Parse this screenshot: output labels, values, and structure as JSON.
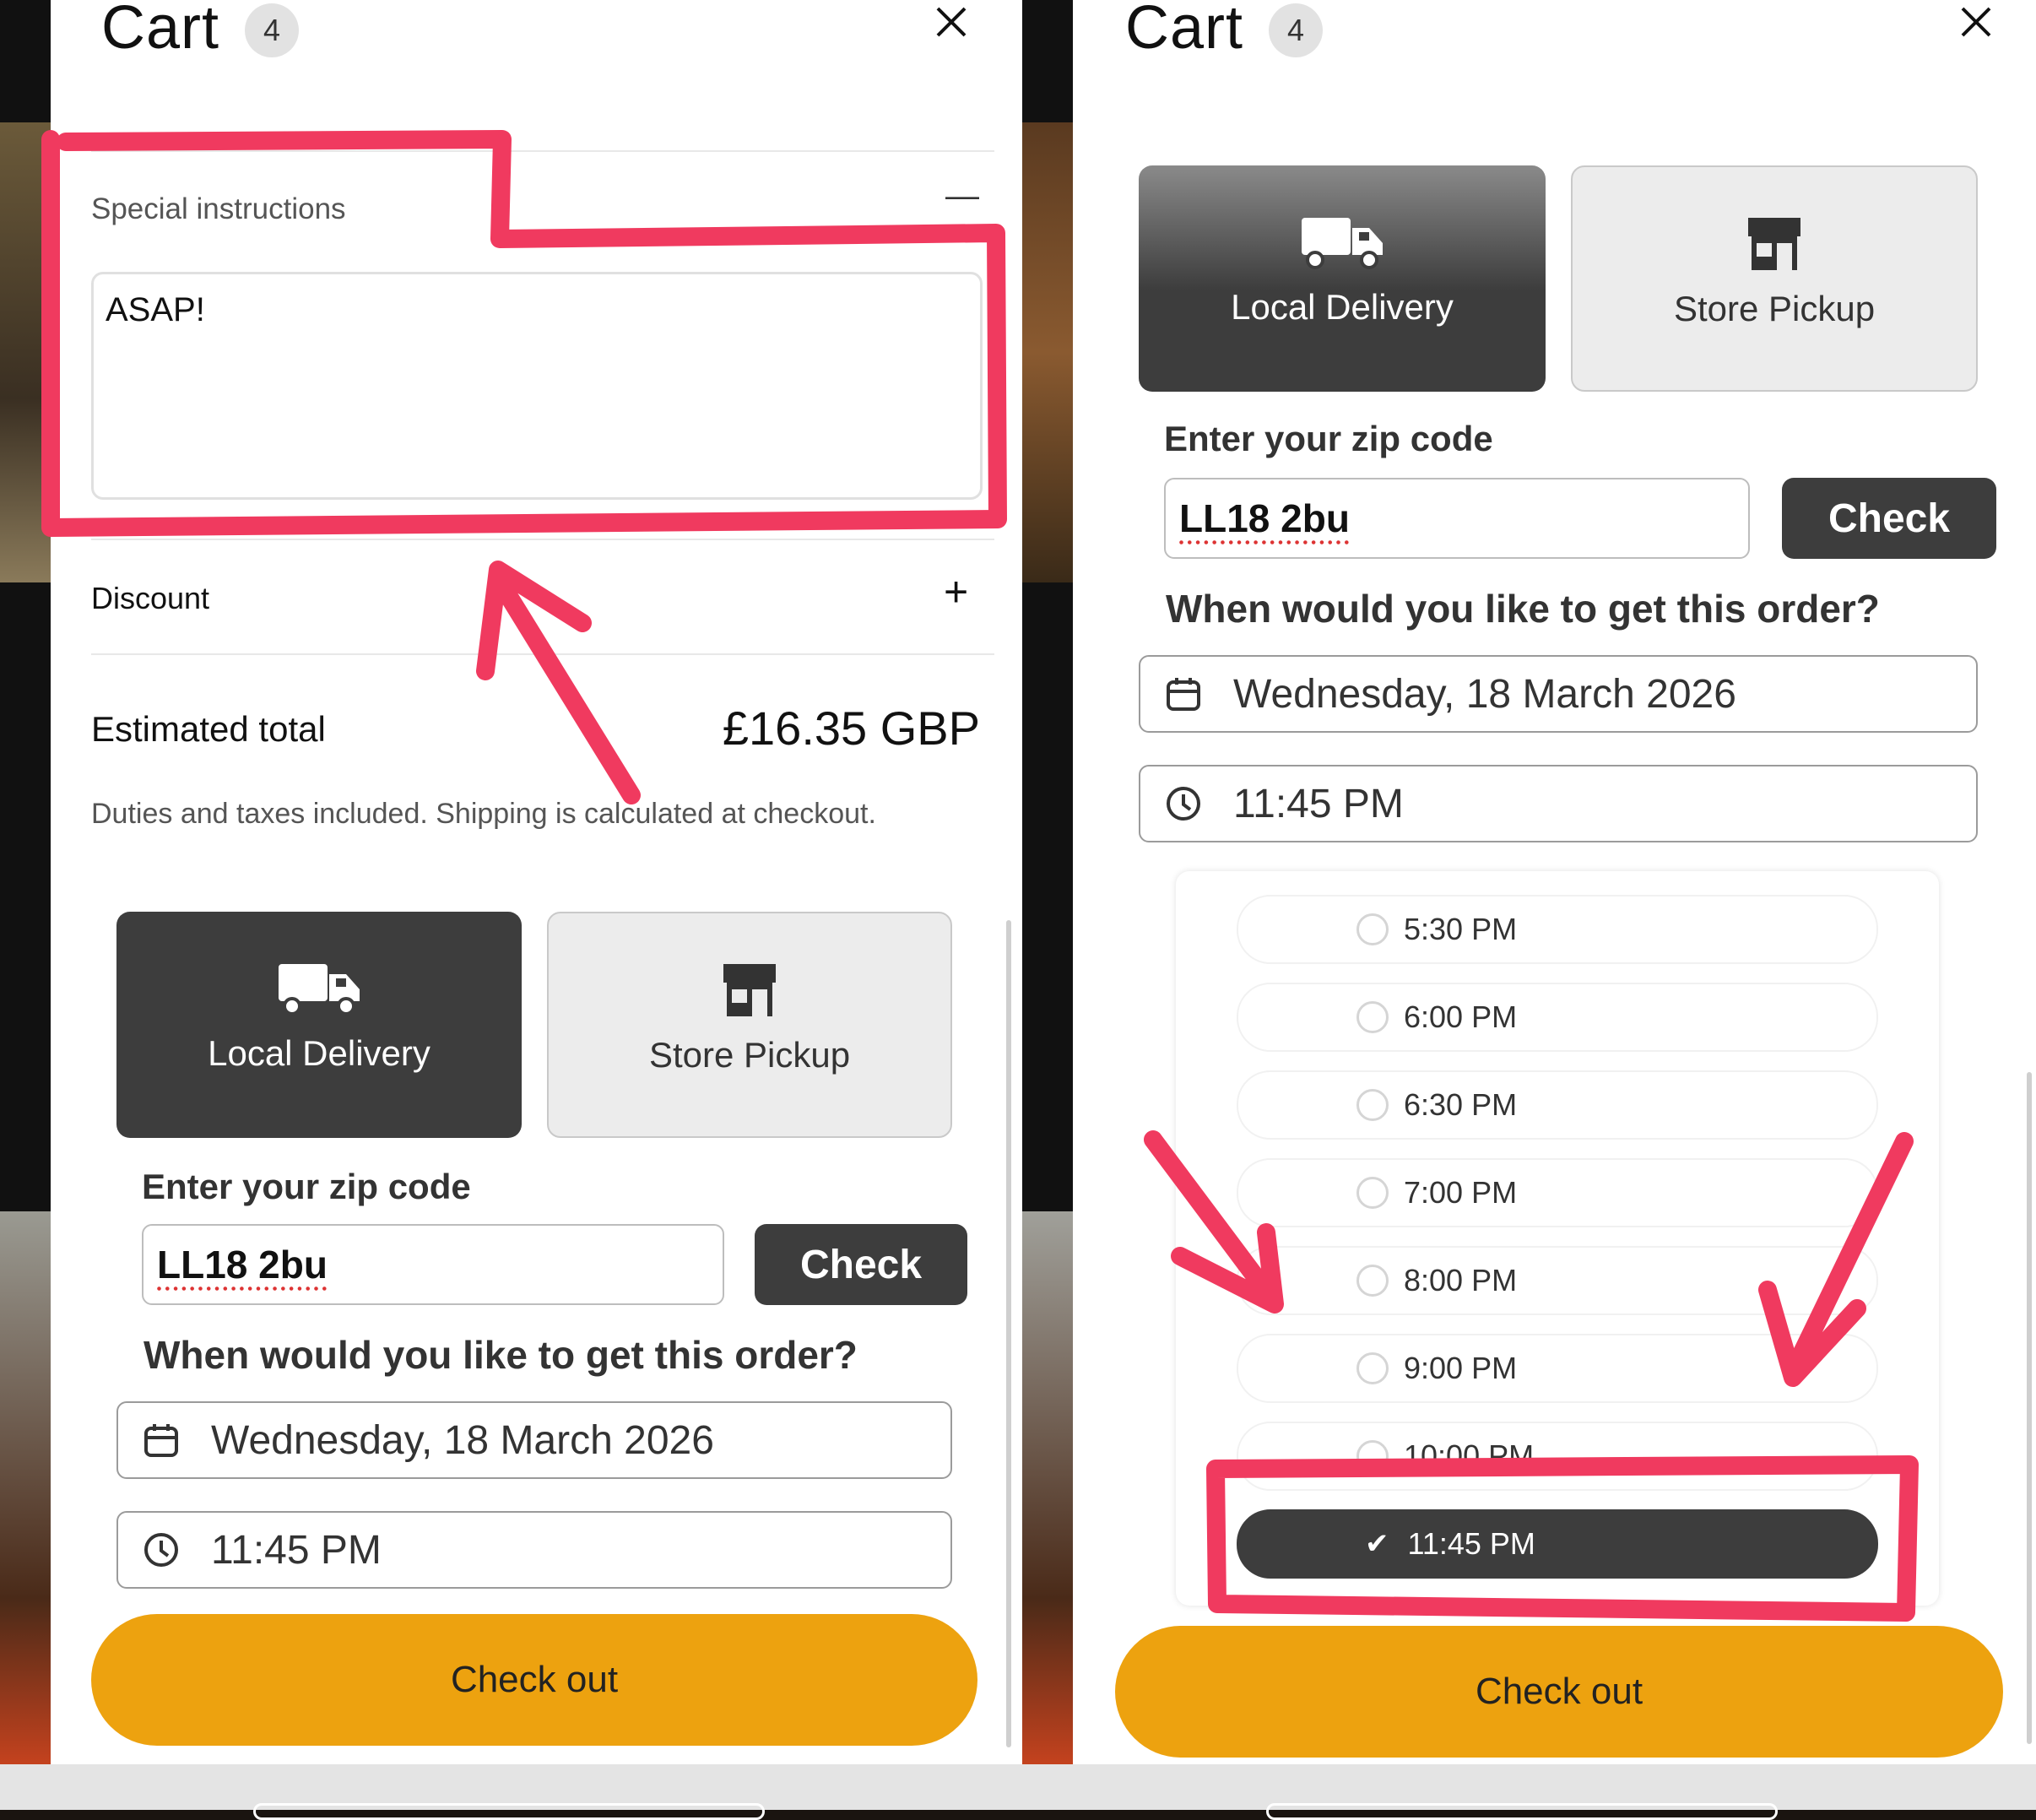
{
  "left": {
    "cart": {
      "title": "Cart",
      "count": "4"
    },
    "special": {
      "label": "Special instructions",
      "toggle": "—",
      "text": "ASAP!"
    },
    "discount": {
      "label": "Discount",
      "toggle": "+"
    },
    "total": {
      "label": "Estimated total",
      "value": "£16.35 GBP",
      "note": "Duties and taxes included. Shipping is calculated at checkout."
    },
    "tabs": {
      "delivery": "Local Delivery",
      "pickup": "Store Pickup"
    },
    "zip": {
      "label": "Enter your zip code",
      "value": "LL18 2bu",
      "check": "Check"
    },
    "question": "When would you like to get this order?",
    "date": "Wednesday, 18 March 2026",
    "time": "11:45 PM",
    "checkout": "Check out"
  },
  "right": {
    "cart": {
      "title": "Cart",
      "count": "4"
    },
    "tabs": {
      "delivery": "Local Delivery",
      "pickup": "Store Pickup"
    },
    "zip": {
      "label": "Enter your zip code",
      "value": "LL18 2bu",
      "check": "Check"
    },
    "question": "When would you like to get this order?",
    "date": "Wednesday, 18 March 2026",
    "time": "11:45 PM",
    "slots": [
      "5:30 PM",
      "6:00 PM",
      "6:30 PM",
      "7:00 PM",
      "8:00 PM",
      "9:00 PM",
      "10:00 PM",
      "11:45 PM"
    ],
    "selected_slot": "11:45 PM",
    "checkout": "Check out"
  },
  "icons": {
    "close": "close-icon",
    "truck": "truck-icon",
    "store": "store-icon",
    "calendar": "calendar-icon",
    "clock": "clock-icon",
    "check": "check-icon"
  },
  "colors": {
    "accent": "#eda20f",
    "dark_button": "#3d3d3d",
    "annotation": "#f03a5f"
  }
}
